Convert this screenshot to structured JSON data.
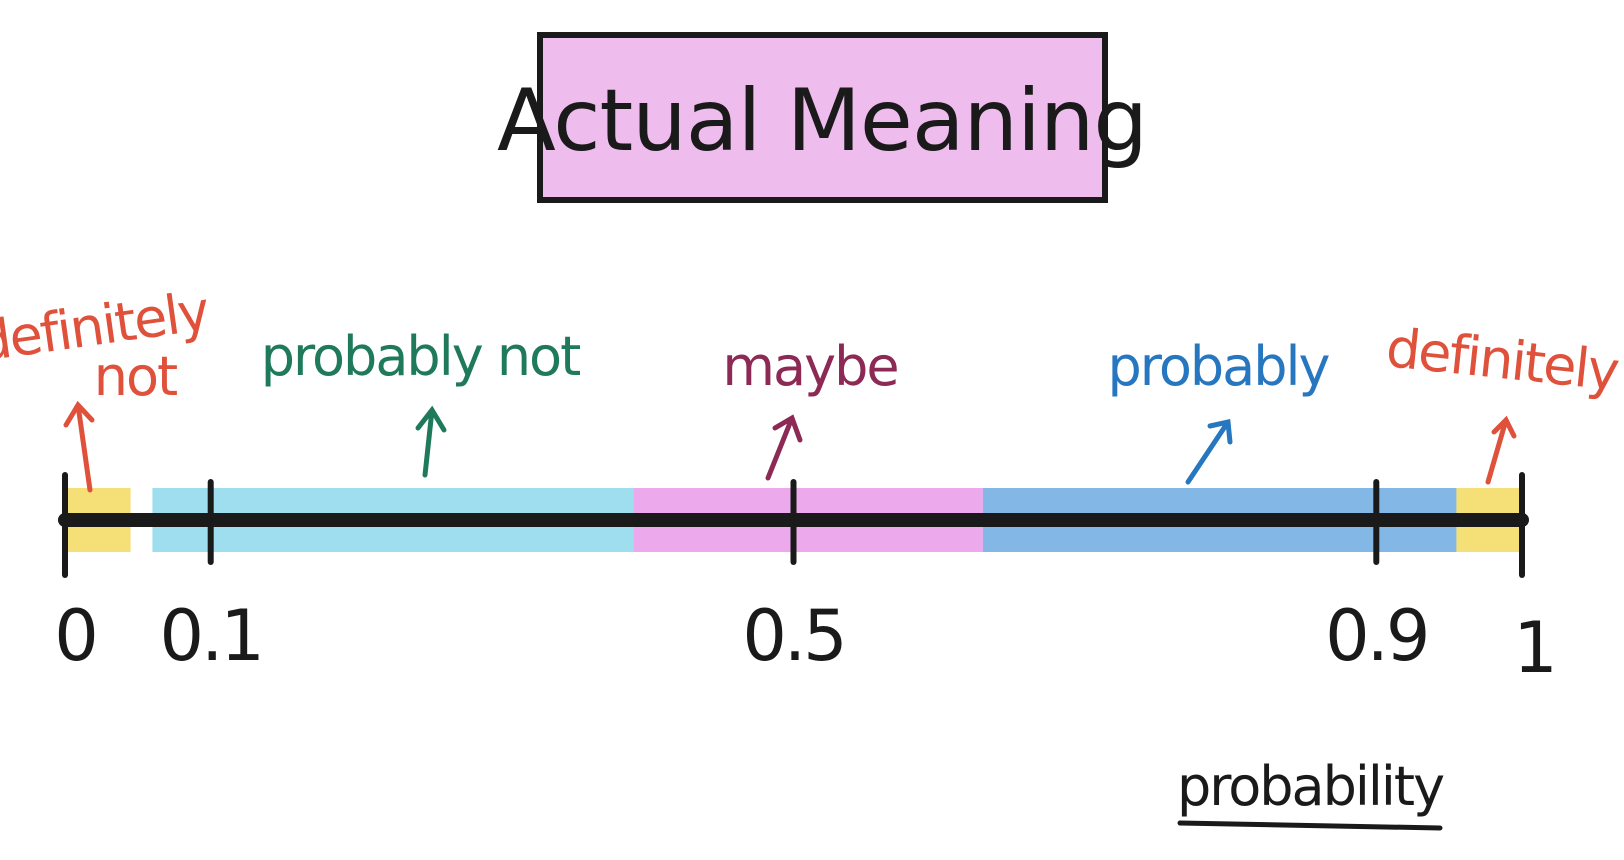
{
  "title": "Actual Meaning",
  "axis": {
    "label": "probability",
    "min": 0,
    "max": 1,
    "ticks": [
      {
        "value": 0,
        "label": "0"
      },
      {
        "value": 0.1,
        "label": "0.1"
      },
      {
        "value": 0.5,
        "label": "0.5"
      },
      {
        "value": 0.9,
        "label": "0.9"
      },
      {
        "value": 1,
        "label": "1"
      }
    ]
  },
  "regions": [
    {
      "name": "definitely not",
      "from": 0.0,
      "to": 0.045,
      "color": "#f2d64a"
    },
    {
      "name": "probably not",
      "from": 0.06,
      "to": 0.39,
      "color": "#7fd3e8"
    },
    {
      "name": "maybe",
      "from": 0.39,
      "to": 0.63,
      "color": "#e58ee6"
    },
    {
      "name": "probably",
      "from": 0.63,
      "to": 0.955,
      "color": "#5a9fdc"
    },
    {
      "name": "definitely",
      "from": 0.955,
      "to": 1.0,
      "color": "#f2d64a"
    }
  ],
  "labels": [
    {
      "id": "definitely-not",
      "line1": "definitely",
      "line2": "not",
      "color": "#e0513c",
      "points_to": 0.015
    },
    {
      "id": "probably-not",
      "line1": "probably not",
      "line2": "",
      "color": "#1f7a5c",
      "points_to": 0.245
    },
    {
      "id": "maybe",
      "line1": "maybe",
      "line2": "",
      "color": "#8c2a55",
      "points_to": 0.485
    },
    {
      "id": "probably",
      "line1": "probably",
      "line2": "",
      "color": "#2676c0",
      "points_to": 0.77
    },
    {
      "id": "definitely",
      "line1": "definitely",
      "line2": "",
      "color": "#e0513c",
      "points_to": 0.975
    }
  ],
  "colors": {
    "ink": "#1a1a1a",
    "title_fill": "#e9a6e8"
  }
}
